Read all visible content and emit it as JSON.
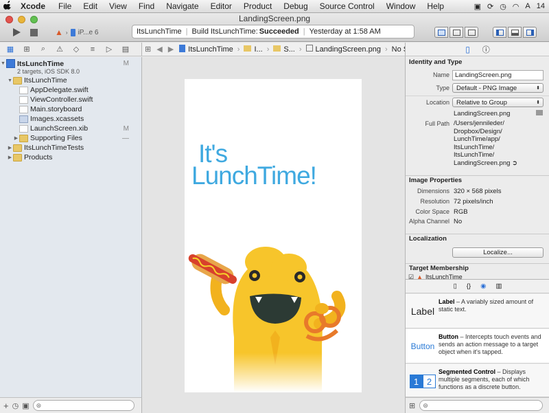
{
  "menubar": {
    "apple_icon": "apple-icon",
    "app_name": "Xcode",
    "items": [
      "File",
      "Edit",
      "View",
      "Find",
      "Navigate",
      "Editor",
      "Product",
      "Debug",
      "Source Control",
      "Window",
      "Help"
    ],
    "battery_text": "14"
  },
  "window": {
    "title": "LandingScreen.png",
    "scheme": "iP...e 6",
    "status": {
      "project": "ItsLunchTime",
      "build_prefix": "Build ItsLunchTime:",
      "build_result": "Succeeded",
      "time": "Yesterday at 1:58 AM"
    }
  },
  "navigator": {
    "project": {
      "name": "ItsLunchTime",
      "subtitle": "2 targets, iOS SDK 8.0",
      "badge": "M"
    },
    "items": [
      {
        "label": "ItsLunchTime",
        "type": "folder",
        "depth": 1,
        "expanded": true
      },
      {
        "label": "AppDelegate.swift",
        "type": "swift",
        "depth": 2
      },
      {
        "label": "ViewController.swift",
        "type": "swift",
        "depth": 2
      },
      {
        "label": "Main.storyboard",
        "type": "file",
        "depth": 2
      },
      {
        "label": "Images.xcassets",
        "type": "xcassets",
        "depth": 2
      },
      {
        "label": "LaunchScreen.xib",
        "type": "file",
        "depth": 2,
        "badge": "M"
      },
      {
        "label": "Supporting Files",
        "type": "folder",
        "depth": 2,
        "expanded": false,
        "badge": "—"
      },
      {
        "label": "ItsLunchTimeTests",
        "type": "folder",
        "depth": 1,
        "expanded": false
      },
      {
        "label": "Products",
        "type": "folder",
        "depth": 1,
        "expanded": false
      }
    ]
  },
  "jumpbar": {
    "items": [
      "ItsLunchTime",
      "I...",
      "S...",
      "LandingScreen.png",
      "No Selection"
    ]
  },
  "canvas": {
    "headline_line1": "It's",
    "headline_line2": "LunchTime!"
  },
  "inspector": {
    "identity": {
      "header": "Identity and Type",
      "name_label": "Name",
      "name_value": "LandingScreen.png",
      "type_label": "Type",
      "type_value": "Default - PNG Image",
      "location_label": "Location",
      "location_value": "Relative to Group",
      "location_file": "LandingScreen.png",
      "fullpath_label": "Full Path",
      "fullpath_lines": [
        "/Users/jennileder/",
        "Dropbox/Design/",
        "LunchTime/app/",
        "ItsLunchTime/",
        "ItsLunchTime/",
        "LandingScreen.png"
      ]
    },
    "image_props": {
      "header": "Image Properties",
      "rows": [
        {
          "label": "Dimensions",
          "value": "320 × 568 pixels"
        },
        {
          "label": "Resolution",
          "value": "72 pixels/inch"
        },
        {
          "label": "Color Space",
          "value": "RGB"
        },
        {
          "label": "Alpha Channel",
          "value": "No"
        }
      ]
    },
    "localization": {
      "header": "Localization",
      "button": "Localize..."
    },
    "target": {
      "header": "Target Membership",
      "item": "ItsLunchTime"
    }
  },
  "library": {
    "items": [
      {
        "thumb": "Label",
        "title": "Label",
        "text": " – A variably sized amount of static text."
      },
      {
        "thumb": "Button",
        "title": "Button",
        "text": " – Intercepts touch events and sends an action message to a target object when it's tapped."
      },
      {
        "thumb_a": "1",
        "thumb_b": "2",
        "title": "Segmented Control",
        "text": " – Displays multiple segments, each of which functions as a discrete button."
      }
    ]
  },
  "colors": {
    "accent": "#3fa9e0",
    "monster": "#f7c52b",
    "selection": "#3d7ad8"
  }
}
